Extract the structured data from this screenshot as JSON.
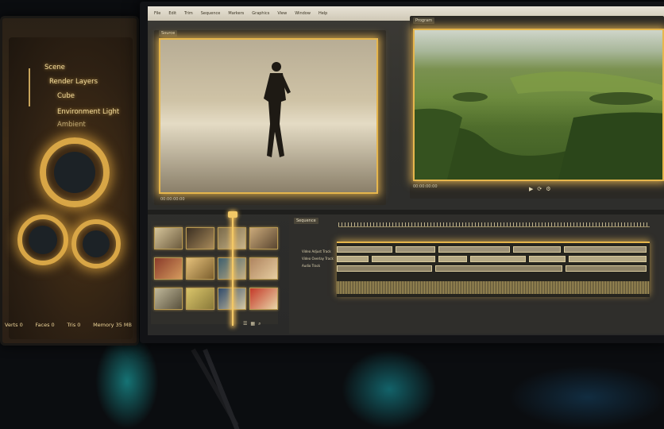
{
  "scene_panel": {
    "tree": {
      "root": "Scene",
      "items": [
        "Render Layers",
        "Cube",
        "Environment Light",
        "Ambient"
      ]
    },
    "status": {
      "verts": "Verts 0",
      "faces": "Faces 0",
      "tris": "Tris 0",
      "memory": "Memory 35 MB"
    }
  },
  "editor": {
    "menu": [
      "File",
      "Edit",
      "Trim",
      "Sequence",
      "Markers",
      "Graphics",
      "View",
      "Window",
      "Help"
    ],
    "source_tab": "Source",
    "program_tab": "Program",
    "source_timecode_left": "00:00:00:00",
    "program_timecode_left": "00:00:00:00",
    "timeline_tab": "Sequence",
    "tracks": [
      "Video Adjust Track",
      "Video Overlay Track",
      "Audio Track"
    ]
  },
  "icons": [
    "play-icon",
    "loop-icon",
    "settings-icon",
    "list-icon",
    "grid-icon",
    "magnify-icon"
  ],
  "colors": {
    "accent_gold": "#e6b64c",
    "screen_bg": "#30302d",
    "glow_teal": "#1ec7c7"
  }
}
